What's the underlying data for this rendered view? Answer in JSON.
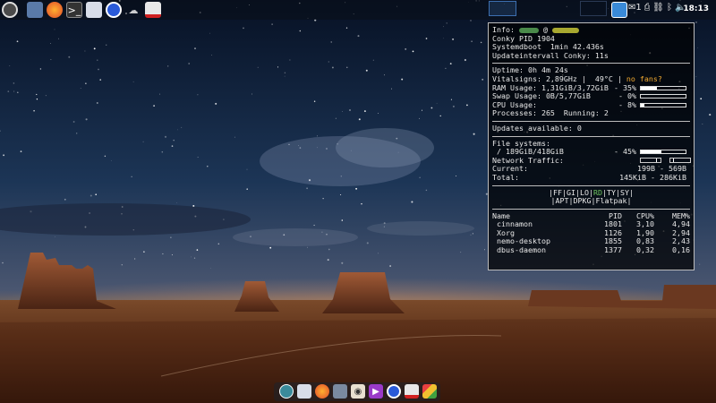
{
  "top_panel": {
    "icons": [
      "menu-icon",
      "files-icon",
      "firefox-icon",
      "terminal-icon",
      "mail-icon",
      "browser-icon",
      "cloud-icon",
      "flatpak-icon"
    ],
    "tray": {
      "update_count": "1",
      "time": "18:13"
    }
  },
  "conky": {
    "info_label": "Info:",
    "info_at": "@",
    "pid": "Conky PID 1904",
    "systemdboot": "Systemdboot  1min 42.436s",
    "update_interval": "Updateintervall Conky: 11s",
    "uptime": "Uptime: 0h 4m 24s",
    "vitals_prefix": "Vitalsigns: 2,89GHz |  49°C | ",
    "no_fans": "no fans?",
    "ram": {
      "label": "RAM Usage: 1,31GiB/3,72GiB",
      "pct": "- 35%",
      "value": 35
    },
    "swap": {
      "label": "Swap Usage: 0B/5,77GiB",
      "pct": "- 0%",
      "value": 0
    },
    "cpu": {
      "label": "CPU Usage:",
      "pct": "- 8%",
      "value": 8
    },
    "processes": "Processes: 265  Running: 2",
    "updates": "Updates available: 0",
    "fs_title": "File systems:",
    "fs_root": {
      "label": " / 189GiB/418GiB",
      "pct": "- 45%",
      "value": 45
    },
    "net_title": "Network Traffic:",
    "current_label": "Current:",
    "current_value": "199B - 569B",
    "total_label": "Total:",
    "total_value": "145KiB - 286KiB",
    "pm_line1": {
      "a": "|FF|GI|LO|",
      "b": "RD",
      "c": "|TY|SY|"
    },
    "pm_line2": "|APT|DPKG|Flatpak|",
    "proc_headers": [
      "Name",
      "PID",
      "CPU%",
      "MEM%"
    ],
    "procs": [
      [
        "cinnamon",
        "1801",
        "3,10",
        "4,94"
      ],
      [
        "Xorg",
        "1126",
        "1,90",
        "2,94"
      ],
      [
        "nemo-desktop",
        "1855",
        "0,83",
        "2,43"
      ],
      [
        "dbus-daemon",
        "1377",
        "0,32",
        "0,16"
      ]
    ]
  },
  "dock": {
    "icons": [
      "software-icon",
      "mail-icon",
      "firefox-icon",
      "files-icon",
      "eye-icon",
      "media-icon",
      "browser-icon",
      "flatpak-icon",
      "maps-icon"
    ]
  },
  "colors": {
    "accent": "#3c6fb0",
    "warning": "#f0a830",
    "highlight": "#6ec55f"
  }
}
